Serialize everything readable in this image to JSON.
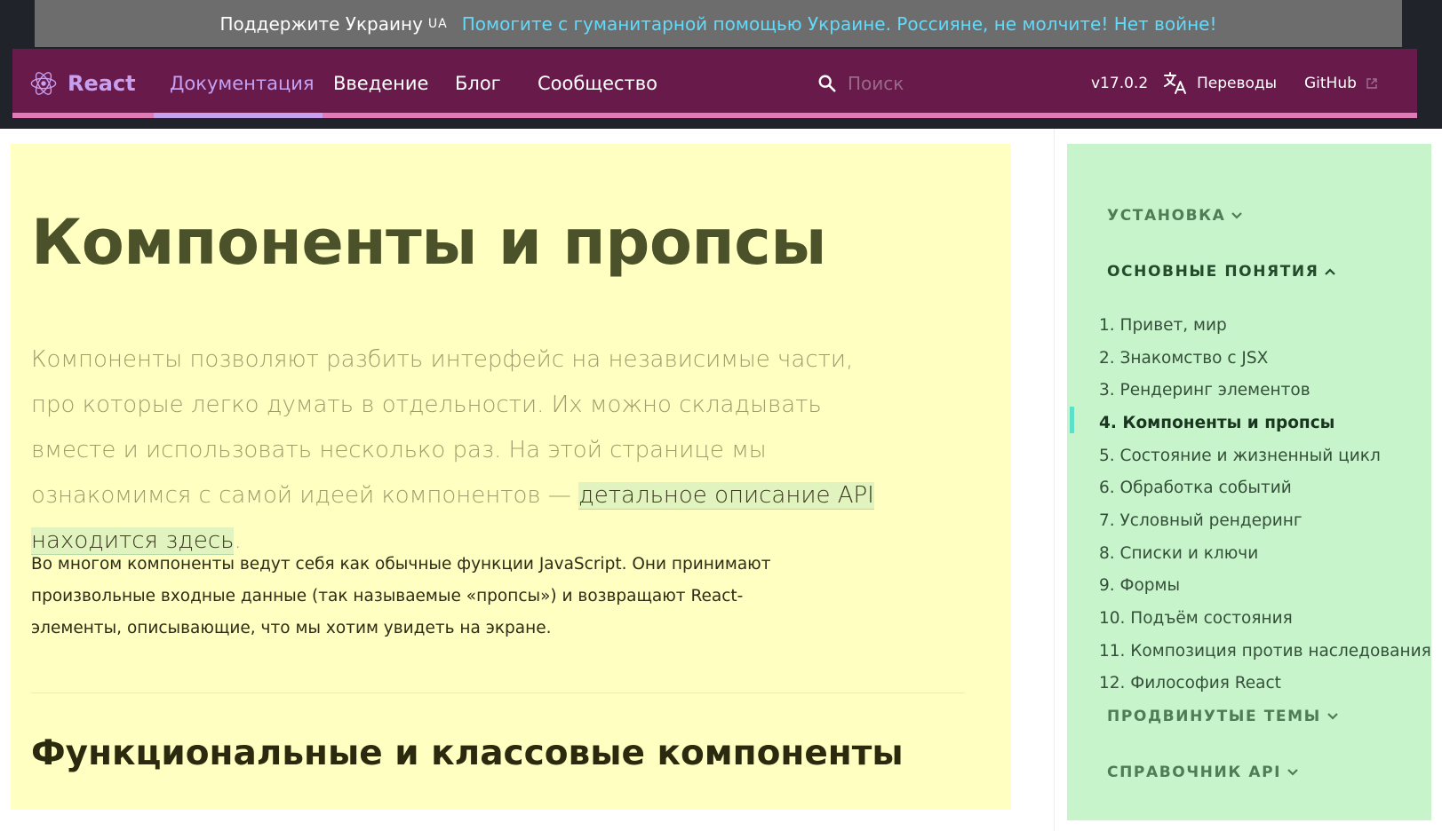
{
  "banner": {
    "support_text": "Поддержите Украину",
    "ua_badge": "UA",
    "help_link": "Помогите с гуманитарной помощью Украине. Россияне, не молчите! Нет войне!"
  },
  "nav": {
    "logo_text": "React",
    "links": [
      "Документация",
      "Введение",
      "Блог",
      "Сообщество"
    ],
    "active_index": 0,
    "search_placeholder": "Поиск",
    "version": "v17.0.2",
    "translations": "Переводы",
    "github": "GitHub"
  },
  "content": {
    "title": "Компоненты и пропсы",
    "lead_text": "Компоненты позволяют разбить интерфейс на независимые части, про которые легко думать в отдельности. Их можно складывать вместе и использовать несколько раз. На этой странице мы ознакомимся с самой идеей компонентов — ",
    "lead_link": "детальное описание API находится здесь",
    "lead_end": ".",
    "paragraph": "Во многом компоненты ведут себя как обычные функции JavaScript. Они принимают произвольные входные данные (так называемые «пропсы») и возвращают React-элементы, описывающие, что мы хотим увидеть на экране.",
    "section_title": "Функциональные и классовые компоненты"
  },
  "sidebar": {
    "sections": [
      {
        "label": "УСТАНОВКА",
        "open": false
      },
      {
        "label": "ОСНОВНЫЕ ПОНЯТИЯ",
        "open": true
      },
      {
        "label": "ПРОДВИНУТЫЕ ТЕМЫ",
        "open": false
      },
      {
        "label": "СПРАВОЧНИК API",
        "open": false
      }
    ],
    "items": [
      "1. Привет, мир",
      "2. Знакомство с JSX",
      "3. Рендеринг элементов",
      "4. Компоненты и пропсы",
      "5. Состояние и жизненный цикл",
      "6. Обработка событий",
      "7. Условный рендеринг",
      "8. Списки и ключи",
      "9. Формы",
      "10. Подъём состояния",
      "11. Композиция против наследования",
      "12. Философия React"
    ],
    "current_index": 3
  },
  "colors": {
    "nav_bg": "#681a4b",
    "nav_accent": "#c7a0f0",
    "content_bg": "#ffffc2",
    "sidebar_bg": "#c8f4cb",
    "current_marker": "#5de0c9"
  }
}
